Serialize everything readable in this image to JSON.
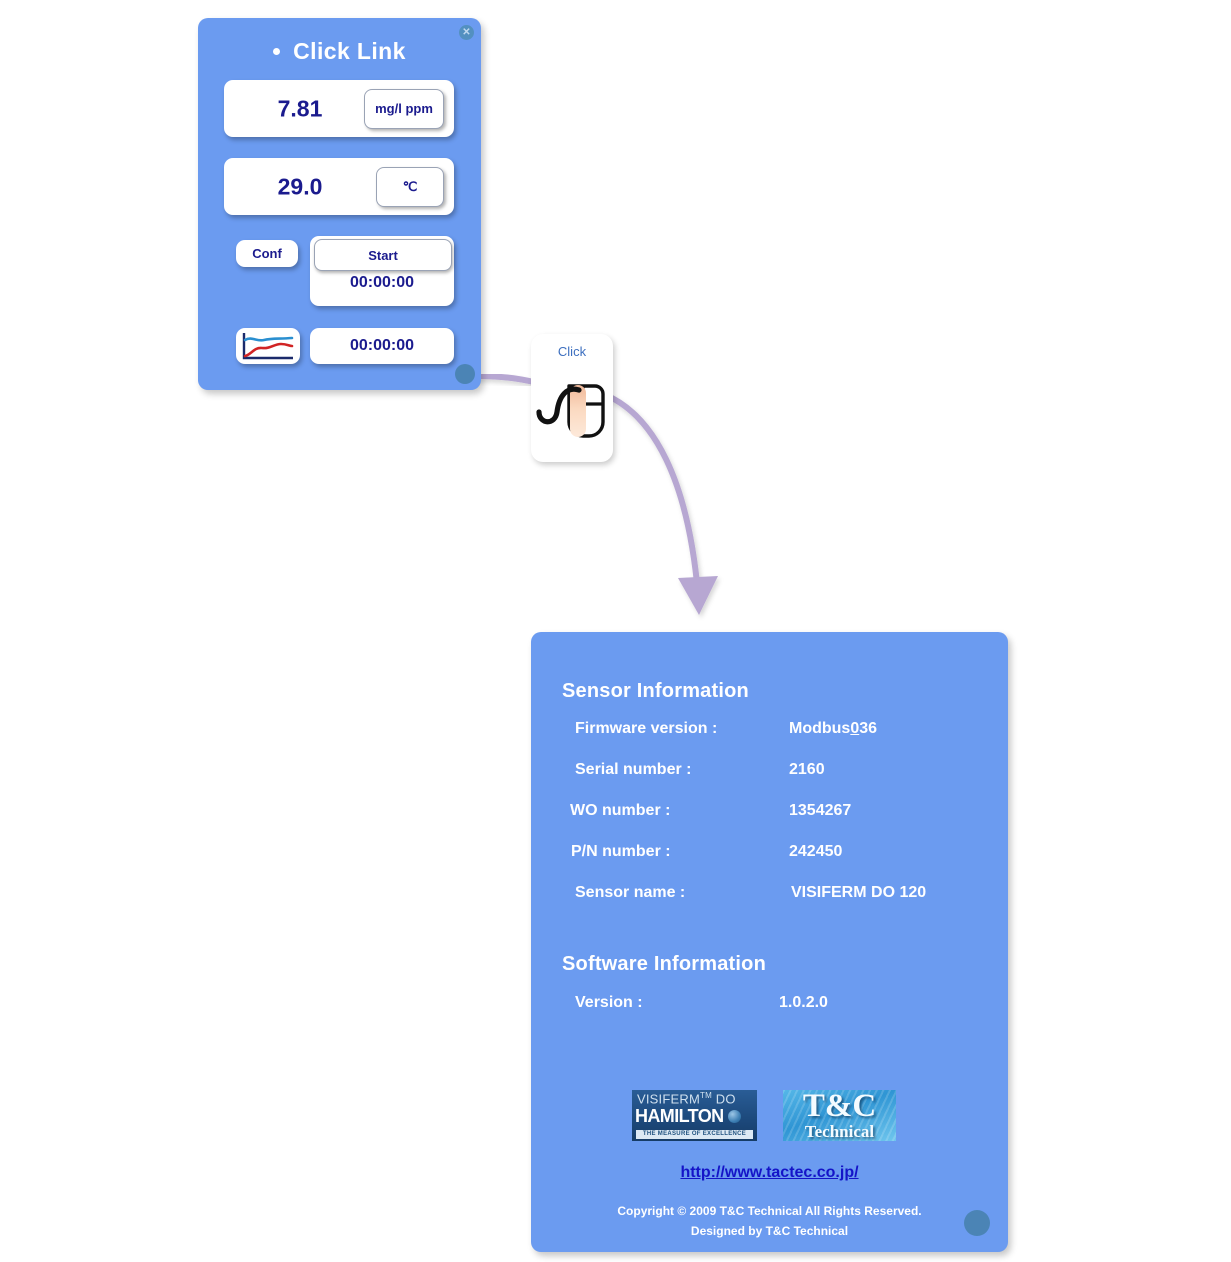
{
  "theme": {
    "panel_blue": "#6b9bf0",
    "value_navy": "#1b1b8e",
    "link_blue": "#1414c8",
    "connector_purple": "#b7a7d2",
    "corner_dot_blue": "#4b84b5"
  },
  "click_link_panel": {
    "title": "Click Link",
    "close_label": "✕",
    "readouts": [
      {
        "value": "7.81",
        "unit": "mg/l ppm"
      },
      {
        "value": "29.0",
        "unit": "℃"
      }
    ],
    "conf_label": "Conf",
    "start_label": "Start",
    "timer_value": "00:00:00",
    "elapsed_value": "00:00:00",
    "graph_icon": "trend-chart-icon"
  },
  "click_badge": {
    "label": "Click",
    "icon": "mouse-click-icon"
  },
  "sensor_panel": {
    "sensor_heading": "Sensor Information",
    "sensor_rows": [
      {
        "label": "Firmware version  :",
        "value": "Modbus036"
      },
      {
        "label": "Serial number   :",
        "value": "2160"
      },
      {
        "label": "WO number   :",
        "value": "1354267"
      },
      {
        "label": "P/N number   :",
        "value": "242450"
      },
      {
        "label": "Sensor name   :",
        "value": "VISIFERM DO 120"
      }
    ],
    "software_heading": "Software Information",
    "software_rows": [
      {
        "label": "Version :",
        "value": "1.0.2.0"
      }
    ],
    "hamilton_logo": {
      "line1": "VISIFERM",
      "line1_sup": "TM",
      "line1_tail": " DO",
      "line2": "HAMILTON",
      "line3": "THE MEASURE OF EXCELLENCE"
    },
    "tc_logo": {
      "main": "T&C",
      "sub": "Technical"
    },
    "site_link": "http://www.tactec.co.jp/",
    "copyright": "Copyright © 2009 T&C Technical All Rights Reserved.",
    "designed_by": "Designed by T&C Technical"
  }
}
